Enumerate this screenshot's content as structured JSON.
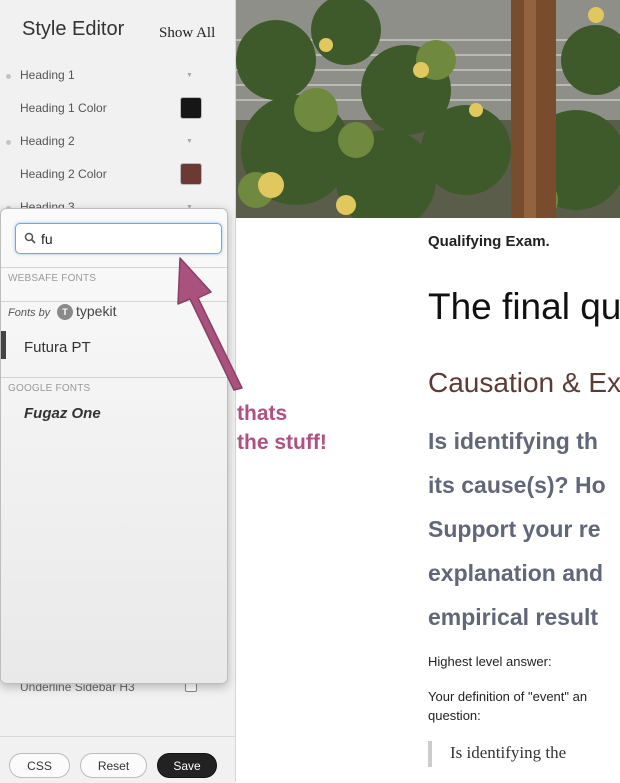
{
  "sidebar": {
    "title": "Style Editor",
    "show_all": "Show All",
    "rows": [
      {
        "label": "Heading 1"
      },
      {
        "label": "Heading 1 Color",
        "color": "#161616"
      },
      {
        "label": "Heading 2"
      },
      {
        "label": "Heading 2 Color",
        "color": "#6b3a35"
      },
      {
        "label": "Heading 3"
      }
    ],
    "hidden_row_label": "Underline Sidebar H3",
    "buttons": {
      "css": "CSS",
      "reset": "Reset",
      "save": "Save"
    }
  },
  "font_picker": {
    "search_value": "fu",
    "websafe_label": "WEBSAFE FONTS",
    "fonts_by": "Fonts by",
    "typekit_name": "typekit",
    "typekit_fonts": [
      "Futura PT"
    ],
    "google_label": "GOOGLE FONTS",
    "google_fonts": [
      "Fugaz One"
    ]
  },
  "annotation": {
    "line1": "thats",
    "line2": "the stuff!",
    "color": "#b04f82"
  },
  "document": {
    "qualifying": "Qualifying Exam.",
    "heading1": "The final qu",
    "heading2": "Causation & Ex",
    "big_lines": [
      "Is identifying th",
      "its cause(s)? Ho",
      "Support your re",
      "explanation and",
      "empirical result"
    ],
    "highest": "Highest level answer:",
    "definition_line1": "Your definition of \"event\" an",
    "definition_line2": "question:",
    "quote": "Is identifying the"
  }
}
